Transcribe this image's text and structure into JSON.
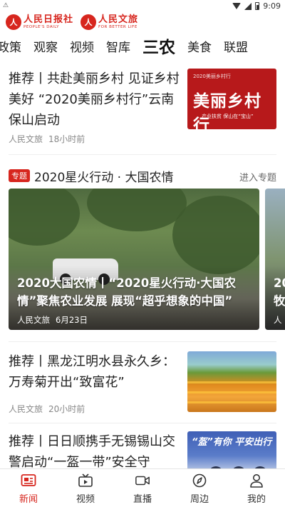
{
  "status_bar": {
    "time": "9:09",
    "notification": "⚠"
  },
  "brands": [
    {
      "mark": "人",
      "name": "人民日报社",
      "sub": "PEOPLE'S DAILY"
    },
    {
      "mark": "人",
      "name": "人民文旅",
      "sub": "FOR BETTER LIFE"
    }
  ],
  "channels": [
    "政策",
    "观察",
    "视频",
    "智库",
    "三农",
    "美食",
    "联盟"
  ],
  "active_channel": "三农",
  "articles": [
    {
      "title": "推荐丨共赴美丽乡村 见证乡村美好 “2020美丽乡村行”云南保山启动",
      "source": "人民文旅",
      "time": "18小时前",
      "thumb": {
        "small": "2020美丽乡村行",
        "big": "美丽乡村行",
        "sub": "产业扶贫 保山在“宝山”"
      }
    },
    {
      "title": "推荐丨黑龙江明水县永久乡：万寿菊开出“致富花”",
      "source": "人民文旅",
      "time": "20小时前"
    },
    {
      "title": "推荐丨日日顺携手无锡锡山交警启动“一盔一带”安全守",
      "thumb": {
        "banner": "“盔”有你 平安出行"
      }
    }
  ],
  "special": {
    "badge": "专题",
    "title": "2020星火行动 · 大国农情",
    "more": "进入专题",
    "slides": [
      {
        "caption": "2020大国农情丨“2020星火行动·大国农情”聚焦农业发展 展现“超乎想象的中国”",
        "source": "人民文旅",
        "date": "6月23日"
      },
      {
        "caption": "20",
        "caption2": "牧",
        "source": "人"
      }
    ]
  },
  "bottom_nav": [
    {
      "label": "新闻",
      "icon": "news-icon",
      "active": true
    },
    {
      "label": "视频",
      "icon": "tv-icon",
      "active": false
    },
    {
      "label": "直播",
      "icon": "video-camera-icon",
      "active": false
    },
    {
      "label": "周边",
      "icon": "compass-icon",
      "active": false
    },
    {
      "label": "我的",
      "icon": "person-icon",
      "active": false
    }
  ],
  "colors": {
    "accent": "#d7261e",
    "text": "#222222",
    "meta": "#888888"
  }
}
